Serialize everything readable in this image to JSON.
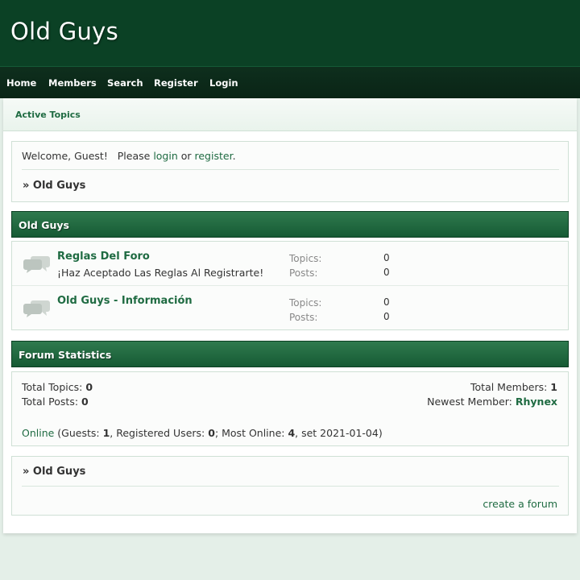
{
  "header": {
    "site_title": "Old Guys"
  },
  "nav": {
    "items": [
      {
        "label": "Home"
      },
      {
        "label": "Members"
      },
      {
        "label": "Search"
      },
      {
        "label": "Register"
      },
      {
        "label": "Login"
      }
    ]
  },
  "subnav": {
    "active_topics": "Active Topics"
  },
  "welcome": {
    "prefix": "Welcome, Guest!   Please ",
    "login": "login",
    "or": " or ",
    "register": "register",
    "suffix": ".",
    "breadcrumb": "» Old Guys"
  },
  "category": {
    "title": "Old Guys",
    "forums": [
      {
        "name": "Reglas Del Foro",
        "description": "¡Haz Aceptado Las Reglas Al Registrarte!",
        "topics_label": "Topics:",
        "topics": "0",
        "posts_label": "Posts:",
        "posts": "0"
      },
      {
        "name": "Old Guys - Información",
        "description": "",
        "topics_label": "Topics:",
        "topics": "0",
        "posts_label": "Posts:",
        "posts": "0"
      }
    ]
  },
  "stats": {
    "title": "Forum Statistics",
    "total_topics_label": "Total Topics: ",
    "total_topics": "0",
    "total_posts_label": "Total Posts: ",
    "total_posts": "0",
    "total_members_label": "Total Members: ",
    "total_members": "1",
    "newest_member_label": "Newest Member: ",
    "newest_member": "Rhynex",
    "online_link": "Online",
    "online_guests_label": " (Guests: ",
    "guests": "1",
    "registered_label": ", Registered Users: ",
    "registered": "0",
    "most_online_label": "; Most Online: ",
    "most_online": "4",
    "most_online_date": ", set 2021-01-04)"
  },
  "footer": {
    "breadcrumb": "» Old Guys",
    "create_forum": "create a forum"
  },
  "colors": {
    "header_bg": "#0b4125",
    "nav_bg": "#0e2f1d",
    "accent": "#1f6b42",
    "category_bar": "#2f7a4e",
    "page_bg": "#e4efe8"
  }
}
